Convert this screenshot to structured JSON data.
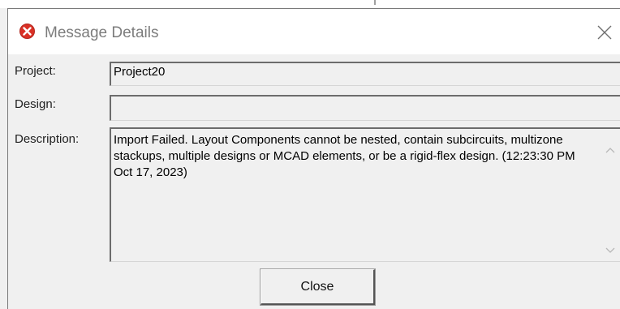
{
  "window": {
    "title": "Message Details",
    "title_icon": "error-icon",
    "close_icon": "close-icon"
  },
  "fields": {
    "project_label": "Project:",
    "project_value": "Project20",
    "design_label": "Design:",
    "design_value": "",
    "description_label": "Description:",
    "description_value": "Import Failed. Layout Components cannot be nested, contain subcircuits, multizone stackups, multiple designs or MCAD elements, or be a rigid-flex design. (12:23:30 PM  Oct 17, 2023)"
  },
  "buttons": {
    "close_label": "Close"
  },
  "colors": {
    "error_icon": "#d93025",
    "title_text": "#7c7c7c",
    "dialog_bg": "#f0f0f0"
  }
}
